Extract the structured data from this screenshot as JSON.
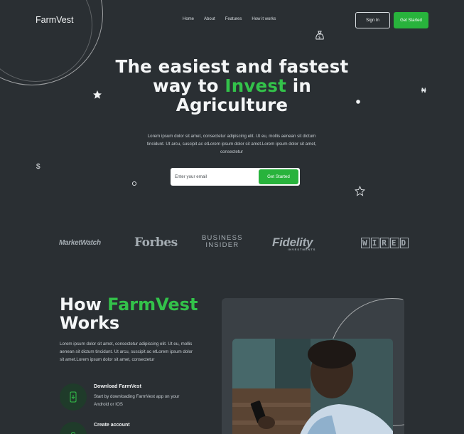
{
  "header": {
    "logo": "FarmVest",
    "nav": [
      "Home",
      "About",
      "Features",
      "How it works"
    ],
    "sign_in": "Sign In",
    "get_started": "Get Started"
  },
  "hero": {
    "title_line1": "The easiest and fastest",
    "title_way": "way to ",
    "title_accent": "Invest",
    "title_in": " in",
    "title_line3": "Agriculture",
    "subtitle": "Lorem ipsum dolor sit amet, consectetur adipiscing elit. Ut eu, mollis aenean sit dictum tincidunt. Ut arcu, suscipit ac etLorem ipsum dolor sit amet.Lorem ipsum dolor sit amet, consectetur",
    "email_placeholder": "Enter your email",
    "email_button": "Get Started"
  },
  "press": {
    "marketwatch": "MarketWatch",
    "forbes": "Forbes",
    "business_insider_1": "BUSINESS",
    "business_insider_2": "INSIDER",
    "fidelity": "Fidelity",
    "fidelity_sub": "INVESTMENTS",
    "wired": [
      "W",
      "I",
      "R",
      "E",
      "D"
    ]
  },
  "how": {
    "title_prefix": "How ",
    "title_accent": "FarmVest",
    "title_line2": "Works",
    "description": "Lorem ipsum dolor sit amet, consectetur adipiscing elit. Ut eu, mollis aenean sit dictum tincidunt. Ut arcu, suscipit ac etLorem ipsum dolor sit amet.Lorem ipsum dolor sit amet, consectetur",
    "steps": [
      {
        "title": "Download FarmVest",
        "text": "Start by downloading FarmVest app on your Android or IOS",
        "icon": "phone-download-icon"
      },
      {
        "title": "Create account",
        "text": "",
        "icon": "account-icon"
      }
    ]
  },
  "colors": {
    "background": "#2a2f33",
    "accent": "#33c24a",
    "button": "#28b33c"
  }
}
